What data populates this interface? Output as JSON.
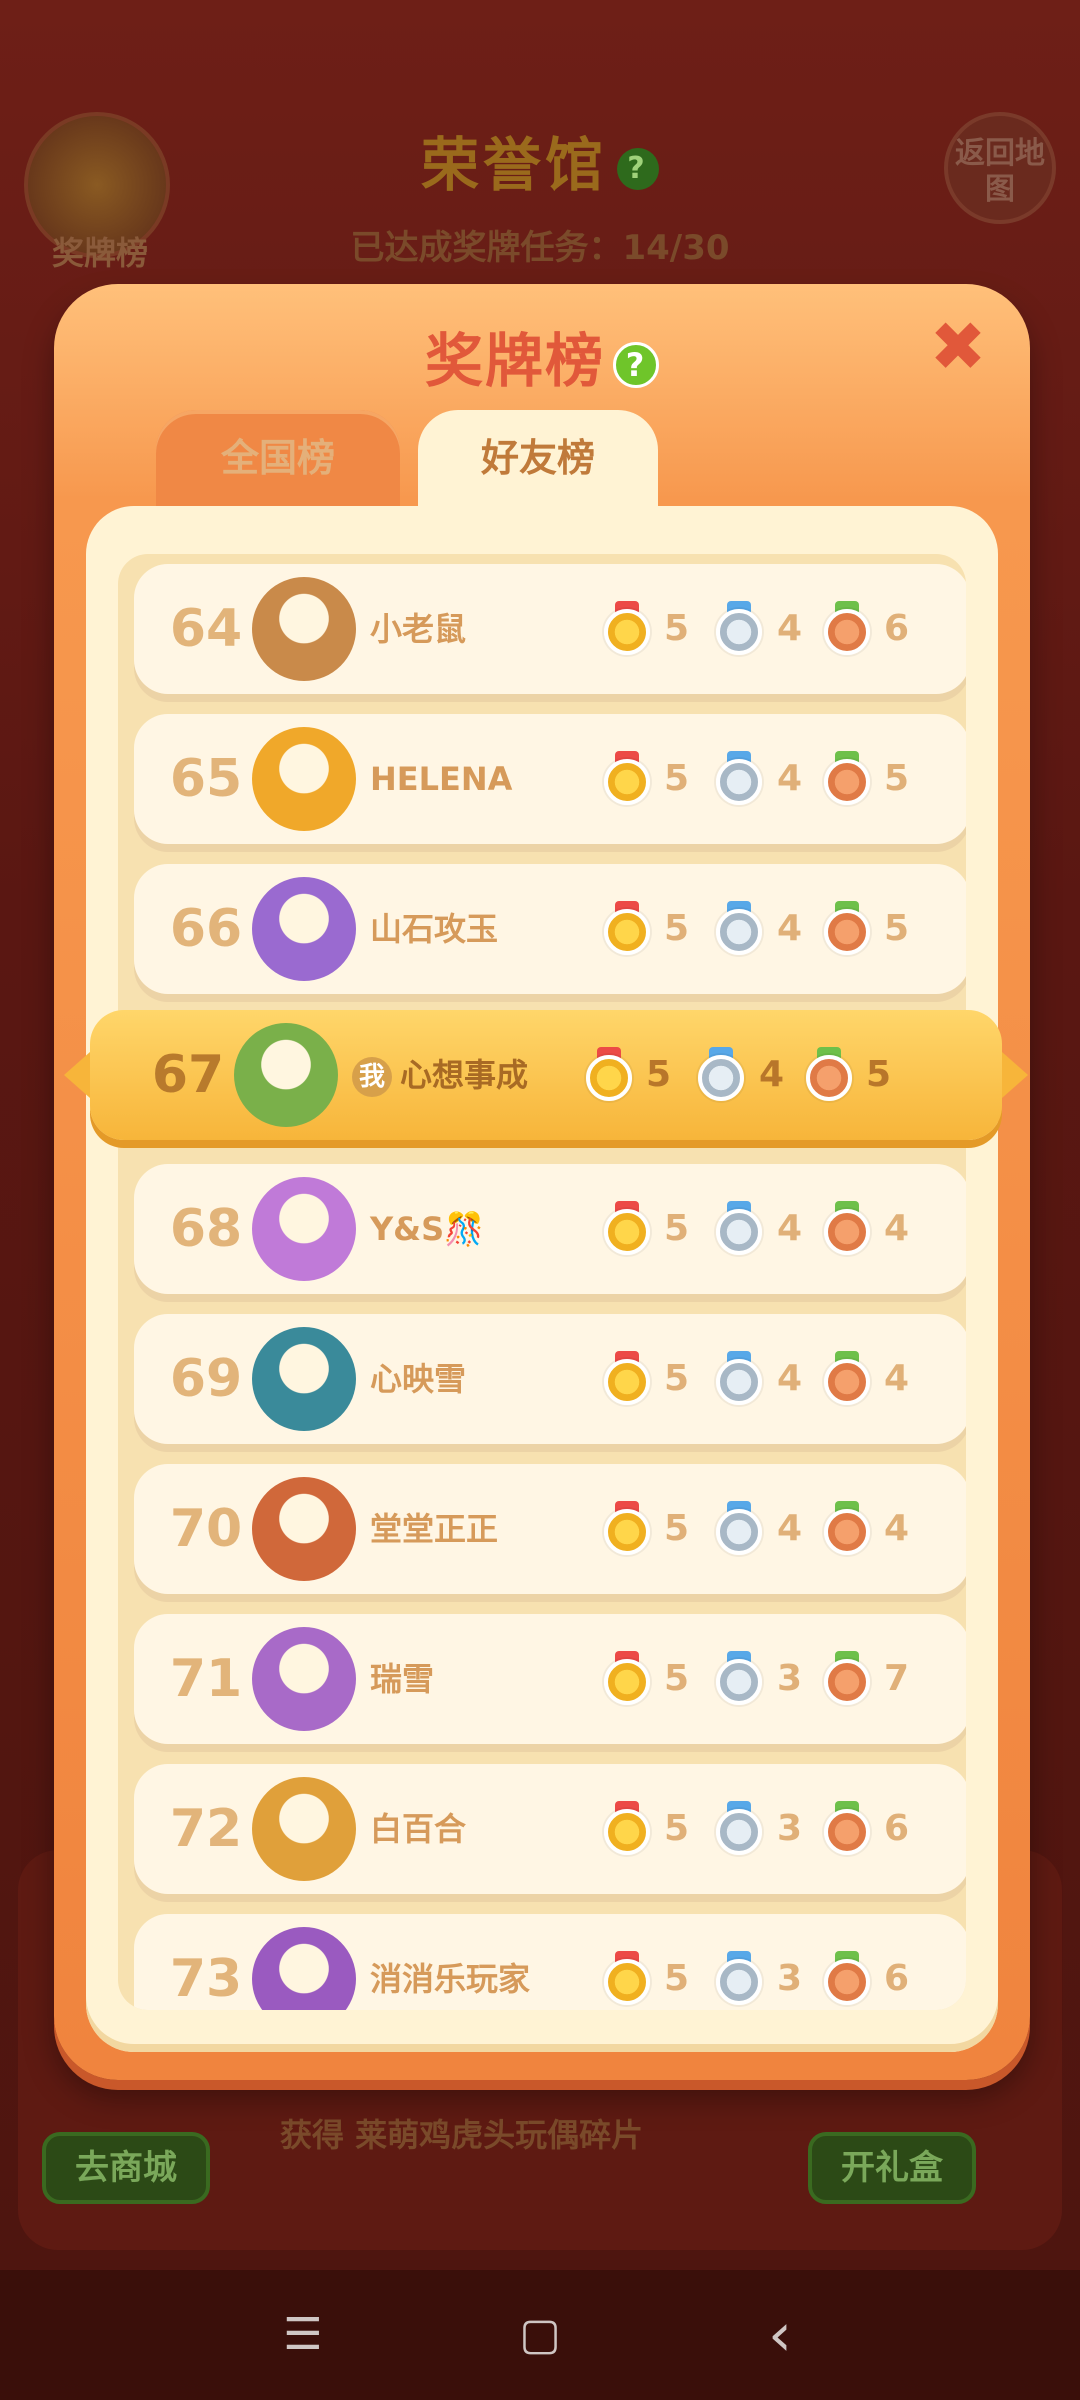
{
  "background": {
    "title": "荣誉馆",
    "help_symbol": "?",
    "progress_text": "已达成奖牌任务：14/30",
    "medal_button_label": "奖牌榜",
    "back_button_label": "返回地图",
    "shop_button_label": "去商城",
    "gift_button_label": "开礼盒",
    "reward_text": "获得 莱萌鸡虎头玩偶碎片"
  },
  "modal": {
    "title": "奖牌榜",
    "help_symbol": "?",
    "close_symbol": "✖",
    "tabs": [
      {
        "label": "全国榜",
        "active": false
      },
      {
        "label": "好友榜",
        "active": true
      }
    ]
  },
  "self_badge": "我",
  "rows": [
    {
      "rank": "64",
      "name": "小老鼠",
      "gold": "5",
      "silver": "4",
      "bronze": "6",
      "avatar_color": "#c98a4a"
    },
    {
      "rank": "65",
      "name": "HELENA",
      "gold": "5",
      "silver": "4",
      "bronze": "5",
      "avatar_color": "#f0a82a"
    },
    {
      "rank": "66",
      "name": "山石攻玉",
      "gold": "5",
      "silver": "4",
      "bronze": "5",
      "avatar_color": "#9a6ad0"
    },
    {
      "rank": "67",
      "name": "心想事成",
      "gold": "5",
      "silver": "4",
      "bronze": "5",
      "avatar_color": "#7ab04a",
      "is_self": true
    },
    {
      "rank": "68",
      "name": "Y&S🎊",
      "gold": "5",
      "silver": "4",
      "bronze": "4",
      "avatar_color": "#c07ad8"
    },
    {
      "rank": "69",
      "name": "心映雪",
      "gold": "5",
      "silver": "4",
      "bronze": "4",
      "avatar_color": "#3a8a9a"
    },
    {
      "rank": "70",
      "name": "堂堂正正",
      "gold": "5",
      "silver": "4",
      "bronze": "4",
      "avatar_color": "#d0683a"
    },
    {
      "rank": "71",
      "name": "瑞雪",
      "gold": "5",
      "silver": "3",
      "bronze": "7",
      "avatar_color": "#a86ac8"
    },
    {
      "rank": "72",
      "name": "白百合",
      "gold": "5",
      "silver": "3",
      "bronze": "6",
      "avatar_color": "#e0a03a"
    },
    {
      "rank": "73",
      "name": "消消乐玩家",
      "gold": "5",
      "silver": "3",
      "bronze": "6",
      "avatar_color": "#9a5ac0"
    }
  ],
  "nav": {
    "menu": "☰",
    "home": "▢",
    "back": "‹"
  }
}
